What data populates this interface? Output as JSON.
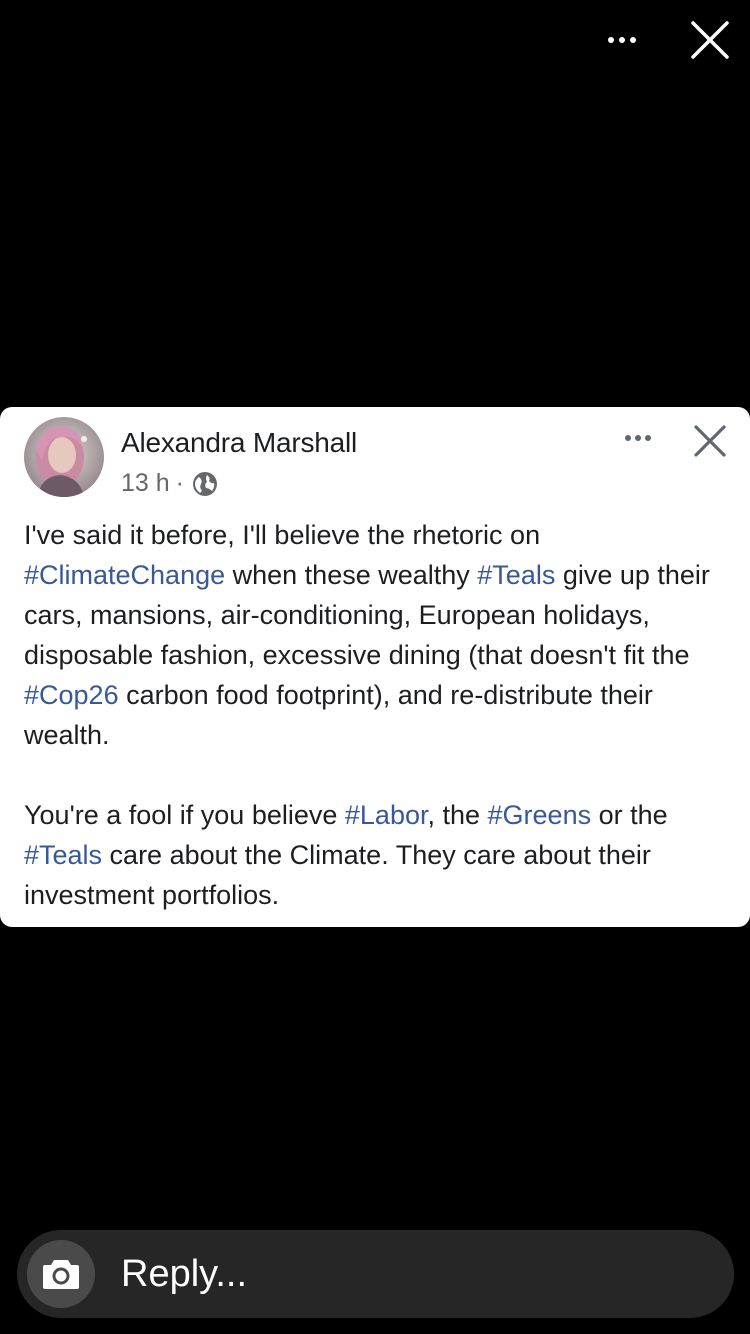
{
  "story": {
    "more_icon": "more-horizontal-icon",
    "close_icon": "close-icon"
  },
  "post": {
    "author": "Alexandra Marshall",
    "time": "13 h",
    "separator": "·",
    "audience_icon": "globe-icon",
    "more_icon": "more-horizontal-icon",
    "close_icon": "close-icon",
    "paragraph1": {
      "t1": "I've said it before, I'll believe the rhetoric on ",
      "tag1": "#ClimateChange",
      "t2": " when these wealthy ",
      "tag2": "#Teals",
      "t3": " give up their cars, mansions, air-conditioning, European holidays, disposable fashion, excessive dining (that doesn't fit the ",
      "tag3": "#Cop26",
      "t4": " carbon food footprint), and re-distribute their wealth."
    },
    "paragraph2": {
      "t1": "You're a fool if you believe ",
      "tag1": "#Labor",
      "t2": ", the ",
      "tag2": "#Greens",
      "t3": " or the ",
      "tag3": "#Teals",
      "t4": " care about the Climate. They care about their investment portfolios."
    },
    "colors": {
      "hashtag": "#385898",
      "text": "#1c1e21",
      "meta": "#65676b"
    }
  },
  "reply": {
    "placeholder": "Reply...",
    "camera_icon": "camera-icon"
  }
}
